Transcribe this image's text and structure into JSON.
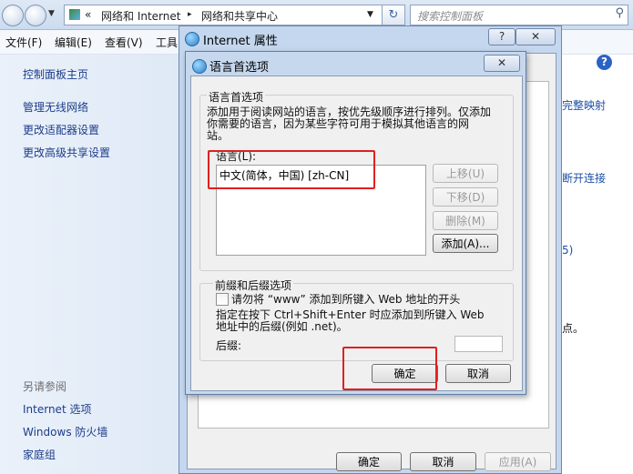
{
  "explorer": {
    "breadcrumb": [
      "«",
      "网络和 Internet",
      "▸",
      "网络和共享中心"
    ],
    "search_placeholder": "搜索控制面板",
    "menu": [
      "文件(F)",
      "编辑(E)",
      "查看(V)",
      "工具"
    ],
    "left_links": [
      "控制面板主页",
      "管理无线网络",
      "更改适配器设置",
      "更改高级共享设置"
    ],
    "see_also_header": "另请参阅",
    "see_also_links": [
      "Internet 选项",
      "Windows 防火墙",
      "家庭组"
    ],
    "right_fragments": [
      "完整映射",
      "断开连接",
      "5)",
      "点。"
    ]
  },
  "internet_options": {
    "title": "Internet 属性",
    "help_btn": "?",
    "close_btn": "✕",
    "buttons": {
      "ok": "确定",
      "cancel": "取消",
      "apply": "应用(A)"
    }
  },
  "language_dialog": {
    "title": "语言首选项",
    "close_btn": "✕",
    "group1_title": "语言首选项",
    "description_lines": [
      "添加用于阅读网站的语言，按优先级顺序进行排列。仅添加",
      "你需要的语言，因为某些字符可用于模拟其他语言的网",
      "站。"
    ],
    "list_label": "语言(L):",
    "languages": [
      "中文(简体，中国) [zh-CN]"
    ],
    "side_buttons": {
      "move_up": "上移(U)",
      "move_down": "下移(D)",
      "remove": "删除(M)",
      "add": "添加(A)..."
    },
    "group2_title": "前缀和后缀选项",
    "checkbox_label": "请勿将 “www” 添加到所键入 Web 地址的开头",
    "ctrl_lines": [
      "指定在按下 Ctrl+Shift+Enter 时应添加到所键入 Web",
      "地址中的后缀(例如 .net)。"
    ],
    "suffix_label": "后缀:",
    "suffix_value": "",
    "ok": "确定",
    "cancel": "取消"
  }
}
